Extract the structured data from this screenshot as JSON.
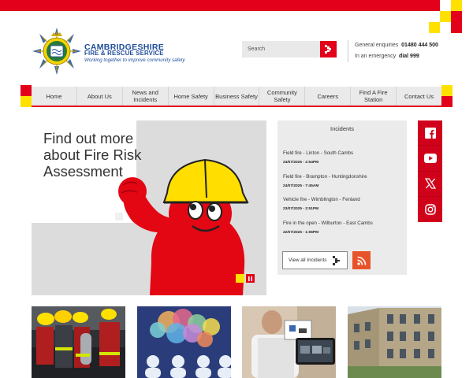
{
  "header": {
    "logo_title": "CAMBRIDGESHIRE",
    "logo_subtitle": "FIRE & RESCUE SERVICE",
    "logo_tagline": "Working together to improve community safety",
    "search_placeholder": "Search",
    "general_enquiries_label": "General enquiries",
    "general_enquiries_number": "01480 444 500",
    "emergency_label": "In an emergency",
    "emergency_number": "dial 999"
  },
  "nav": {
    "items": [
      {
        "label": "Home"
      },
      {
        "label": "About Us"
      },
      {
        "label": "News and Incidents"
      },
      {
        "label": "Home Safety"
      },
      {
        "label": "Business Safety"
      },
      {
        "label": "Community Safety"
      },
      {
        "label": "Careers"
      },
      {
        "label": "Find A Fire Station"
      },
      {
        "label": "Contact Us"
      }
    ]
  },
  "hero": {
    "title": "Find out more about Fire Risk Assessment"
  },
  "incidents": {
    "title": "Incidents",
    "items": [
      {
        "name": "Field fire - Linton - South Cambs",
        "date": "24/07/2025 - 2:54PM"
      },
      {
        "name": "Field fire - Brampton - Huntingdonshire",
        "date": "24/07/2025 - 7:45AM"
      },
      {
        "name": "Vehicle fire - Wimblington - Fenland",
        "date": "23/07/2025 - 2:51PM"
      },
      {
        "name": "Fire in the open - Wilburton - East Cambs",
        "date": "22/07/2025 - 1:56PM"
      }
    ],
    "view_all_label": "View all Incidents"
  },
  "social": {
    "items": [
      {
        "icon": "facebook-icon"
      },
      {
        "icon": "youtube-icon"
      },
      {
        "icon": "x-icon"
      },
      {
        "icon": "instagram-icon"
      }
    ]
  },
  "colors": {
    "brand_red": "#e2001a",
    "brand_yellow": "#ffe100",
    "brand_blue": "#1f4e9b",
    "rss_orange": "#e8542a"
  }
}
